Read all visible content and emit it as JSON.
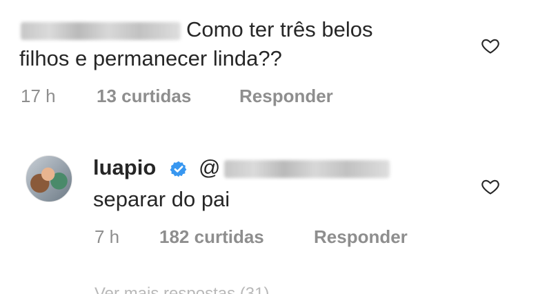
{
  "comment": {
    "text_line1": "Como ter três belos",
    "text_line2": "filhos e permanecer linda??",
    "time": "17 h",
    "likes": "13 curtidas",
    "reply": "Responder"
  },
  "reply": {
    "username": "luapio",
    "mention_prefix": "@",
    "text": "separar do pai",
    "time": "7 h",
    "likes": "182 curtidas",
    "reply": "Responder"
  },
  "footer": {
    "more_replies": "Ver mais respostas (31)"
  },
  "icons": {
    "heart": "heart-outline-icon",
    "verified": "verified-badge-icon"
  },
  "colors": {
    "meta_gray": "#8e8e8e",
    "verified_blue": "#3897f0"
  }
}
